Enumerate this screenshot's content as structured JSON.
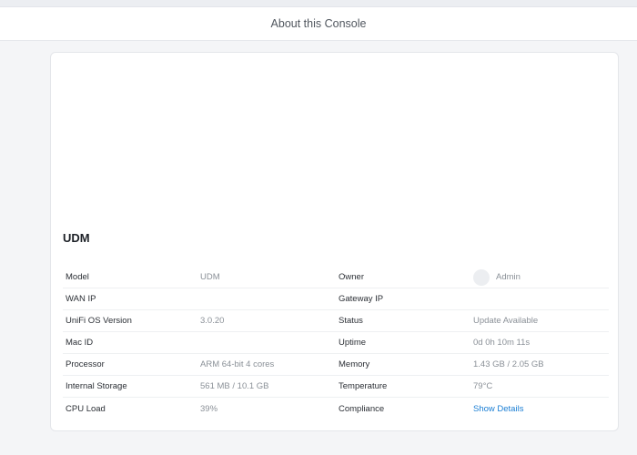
{
  "header": {
    "title": "About this Console"
  },
  "device": {
    "name": "UDM"
  },
  "info": {
    "rows": [
      {
        "left_label": "Model",
        "left_value": "UDM",
        "right_label": "Owner",
        "right_value": "Admin"
      },
      {
        "left_label": "WAN IP",
        "left_value": "",
        "right_label": "Gateway IP",
        "right_value": ""
      },
      {
        "left_label": "UniFi OS Version",
        "left_value": "3.0.20",
        "right_label": "Status",
        "right_value": "Update Available"
      },
      {
        "left_label": "Mac ID",
        "left_value": "",
        "right_label": "Uptime",
        "right_value": "0d 0h 10m 11s"
      },
      {
        "left_label": "Processor",
        "left_value": "ARM 64-bit 4 cores",
        "right_label": "Memory",
        "right_value": "1.43 GB / 2.05 GB"
      },
      {
        "left_label": "Internal Storage",
        "left_value": "561 MB / 10.1 GB",
        "right_label": "Temperature",
        "right_value": "79°C"
      },
      {
        "left_label": "CPU Load",
        "left_value": "39%",
        "right_label": "Compliance",
        "right_value": "Show Details"
      }
    ]
  },
  "icons": {
    "owner_avatar": "avatar-icon"
  },
  "colors": {
    "link": "#1a7ed4"
  }
}
